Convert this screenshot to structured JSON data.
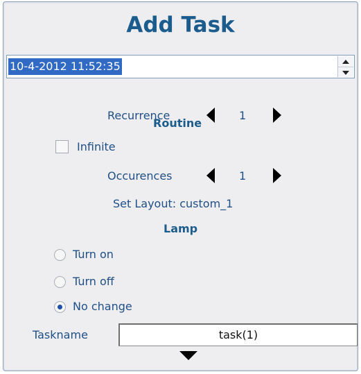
{
  "title": "Add Task",
  "datetime": {
    "value": "10-4-2012 11:52:35"
  },
  "recurrence": {
    "label": "Recurrence",
    "value": "1"
  },
  "routine": {
    "heading": "Routine",
    "infinite_label": "Infinite",
    "infinite_checked": false,
    "occurences_label": "Occurences",
    "occurences_value": "1",
    "set_layout": "Set Layout: custom_1"
  },
  "lamp": {
    "heading": "Lamp",
    "options": [
      "Turn on",
      "Turn off",
      "No change"
    ],
    "selected": "No change"
  },
  "taskname": {
    "label": "Taskname",
    "value": "task(1)"
  },
  "icons": {
    "spin_up": "spin-up-icon",
    "spin_down": "spin-down-icon",
    "decrement": "triangle-left-icon",
    "increment": "triangle-right-icon",
    "expand": "triangle-down-icon"
  },
  "colors": {
    "heading": "#1b5c8c",
    "label": "#1f4f86",
    "selection": "#316ac5",
    "panel": "#eeeef0"
  }
}
